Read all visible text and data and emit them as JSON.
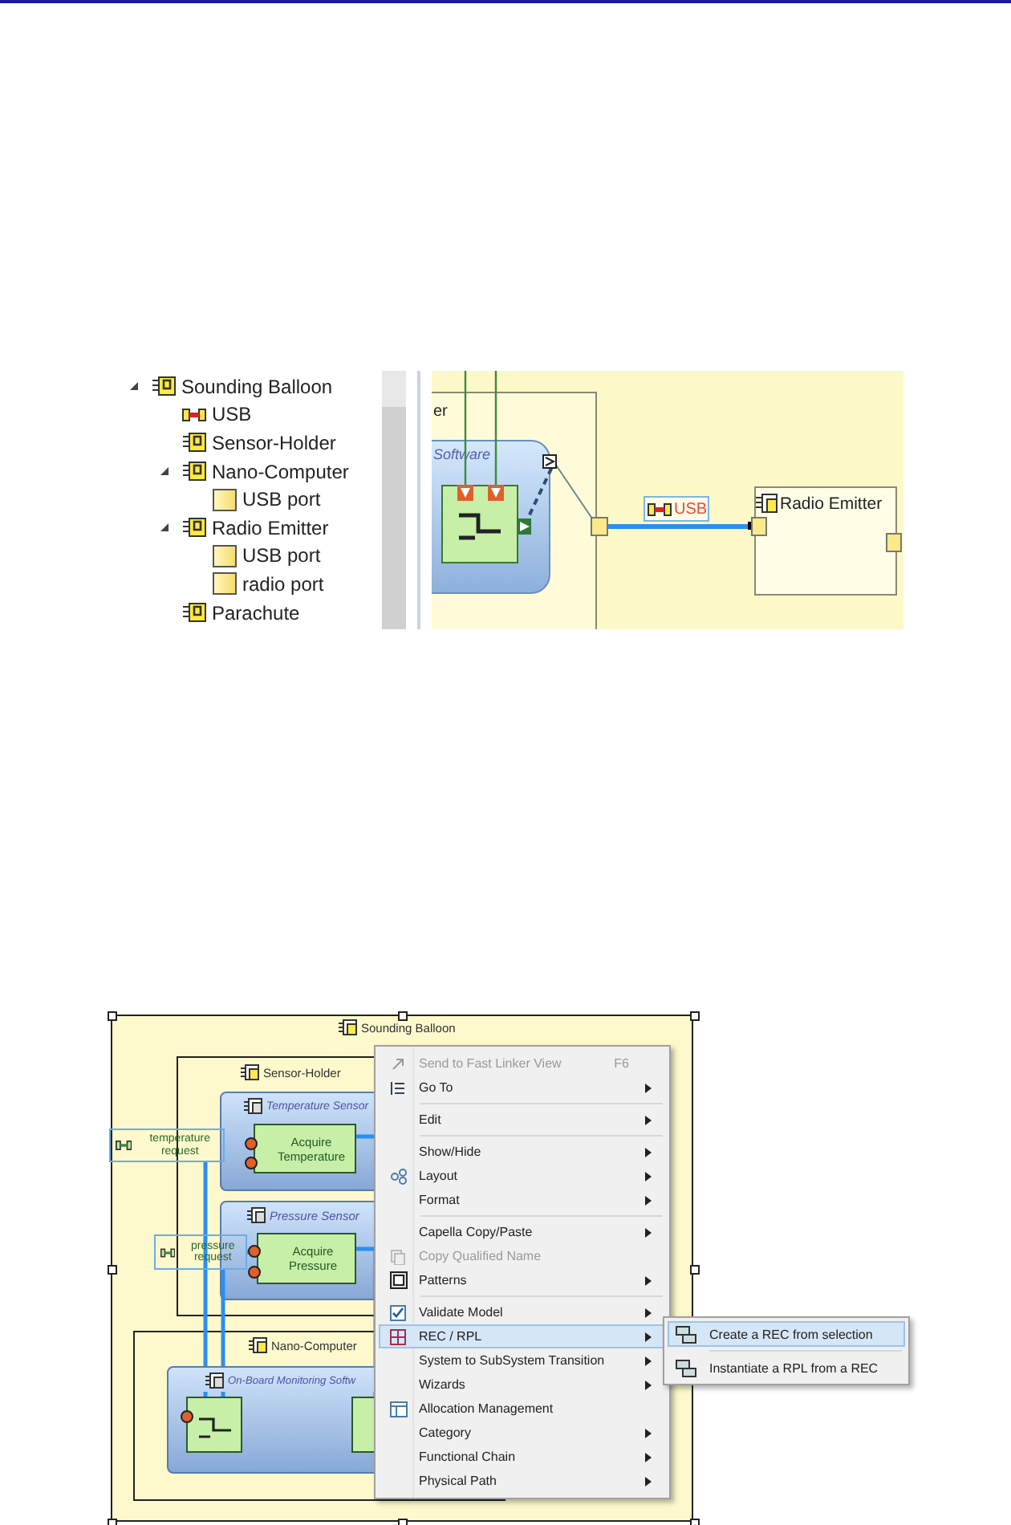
{
  "tree": [
    {
      "label": "Sounding Balloon",
      "kind": "component",
      "expanded": true,
      "children": [
        {
          "label": "USB",
          "kind": "link"
        },
        {
          "label": "Sensor-Holder",
          "kind": "component"
        },
        {
          "label": "Nano-Computer",
          "kind": "component",
          "expanded": true,
          "children": [
            {
              "label": "USB port",
              "kind": "port"
            }
          ]
        },
        {
          "label": "Radio Emitter",
          "kind": "component",
          "expanded": true,
          "children": [
            {
              "label": "USB port",
              "kind": "port"
            },
            {
              "label": "radio port",
              "kind": "port"
            }
          ]
        },
        {
          "label": "Parachute",
          "kind": "component"
        }
      ]
    }
  ],
  "diagram_top": {
    "container_label": "er",
    "software_label": "Software",
    "link_label": "USB",
    "emitter_label": "Radio Emitter"
  },
  "diagram_bottom": {
    "frame_label": "Sounding Balloon",
    "sensor_holder_label": "Sensor-Holder",
    "temperature_sensor_label": "Temperature Sensor",
    "acquire_temperature": "Acquire Temperature",
    "temperature_request": "temperature request",
    "pressure_sensor_label": "Pressure Sensor",
    "acquire_pressure": "Acquire Pressure",
    "pressure_request": "pressure request",
    "nano_computer_label": "Nano-Computer",
    "software_label": "On-Board Monitoring Softw"
  },
  "context_menu": {
    "items": [
      {
        "kind": "item",
        "label": "Send to Fast Linker View",
        "shortcut": "F6",
        "disabled": true,
        "selected": false,
        "submenu": false
      },
      {
        "kind": "item",
        "label": "Go To",
        "disabled": false,
        "selected": false,
        "submenu": true
      },
      {
        "kind": "separator"
      },
      {
        "kind": "item",
        "label": "Edit",
        "disabled": false,
        "selected": false,
        "submenu": true
      },
      {
        "kind": "separator"
      },
      {
        "kind": "item",
        "label": "Show/Hide",
        "disabled": false,
        "selected": false,
        "submenu": true
      },
      {
        "kind": "item",
        "label": "Layout",
        "disabled": false,
        "selected": false,
        "submenu": true
      },
      {
        "kind": "item",
        "label": "Format",
        "disabled": false,
        "selected": false,
        "submenu": true
      },
      {
        "kind": "separator"
      },
      {
        "kind": "item",
        "label": "Capella Copy/Paste",
        "disabled": false,
        "selected": false,
        "submenu": true
      },
      {
        "kind": "item",
        "label": "Copy Qualified Name",
        "disabled": true,
        "selected": false,
        "submenu": false
      },
      {
        "kind": "item",
        "label": "Patterns",
        "disabled": false,
        "selected": false,
        "submenu": true
      },
      {
        "kind": "separator"
      },
      {
        "kind": "item",
        "label": "Validate Model",
        "disabled": false,
        "selected": false,
        "submenu": true
      },
      {
        "kind": "item",
        "label": "REC / RPL",
        "disabled": false,
        "selected": true,
        "submenu": true
      },
      {
        "kind": "item",
        "label": "System to SubSystem Transition",
        "disabled": false,
        "selected": false,
        "submenu": true
      },
      {
        "kind": "item",
        "label": "Wizards",
        "disabled": false,
        "selected": false,
        "submenu": true
      },
      {
        "kind": "item",
        "label": "Allocation Management",
        "disabled": false,
        "selected": false,
        "submenu": false
      },
      {
        "kind": "item",
        "label": "Category",
        "disabled": false,
        "selected": false,
        "submenu": true
      },
      {
        "kind": "item",
        "label": "Functional Chain",
        "disabled": false,
        "selected": false,
        "submenu": true
      },
      {
        "kind": "item",
        "label": "Physical Path",
        "disabled": false,
        "selected": false,
        "submenu": true
      }
    ]
  },
  "submenu": {
    "items": [
      {
        "kind": "item",
        "label": "Create a REC from selection",
        "selected": true
      },
      {
        "kind": "separator"
      },
      {
        "kind": "item",
        "label": "Instantiate a RPL from a REC",
        "selected": false
      }
    ]
  }
}
